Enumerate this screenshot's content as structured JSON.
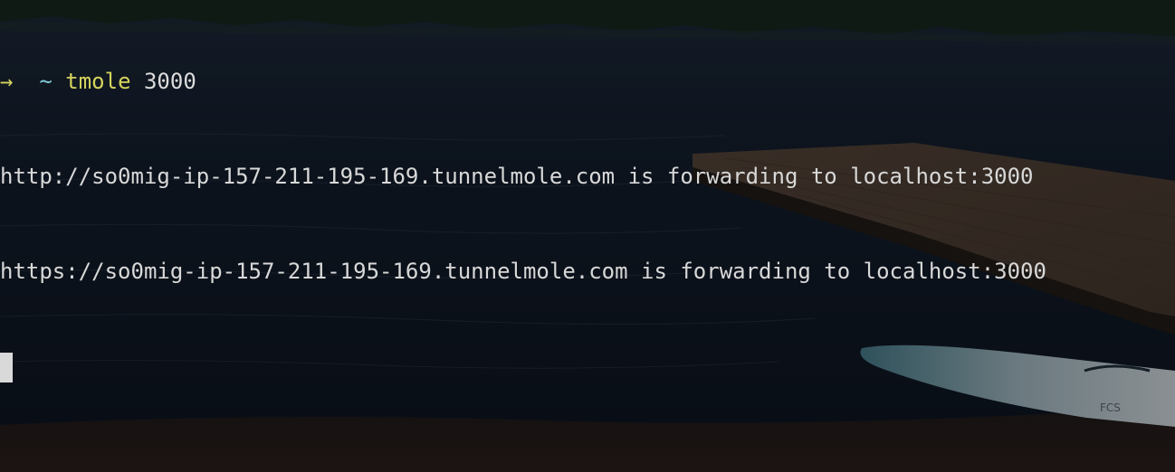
{
  "terminal": {
    "prompt_arrow": "→",
    "prompt_dir": "~",
    "command": "tmole",
    "command_arg": "3000",
    "output_lines": [
      "http://so0mig-ip-157-211-195-169.tunnelmole.com is forwarding to localhost:3000",
      "https://so0mig-ip-157-211-195-169.tunnelmole.com is forwarding to localhost:3000"
    ]
  },
  "colors": {
    "prompt_arrow": "#d7d45d",
    "prompt_dir": "#7ec8d8",
    "command": "#d7d45d",
    "output": "#d8d8d8",
    "background": "#0f1622"
  }
}
